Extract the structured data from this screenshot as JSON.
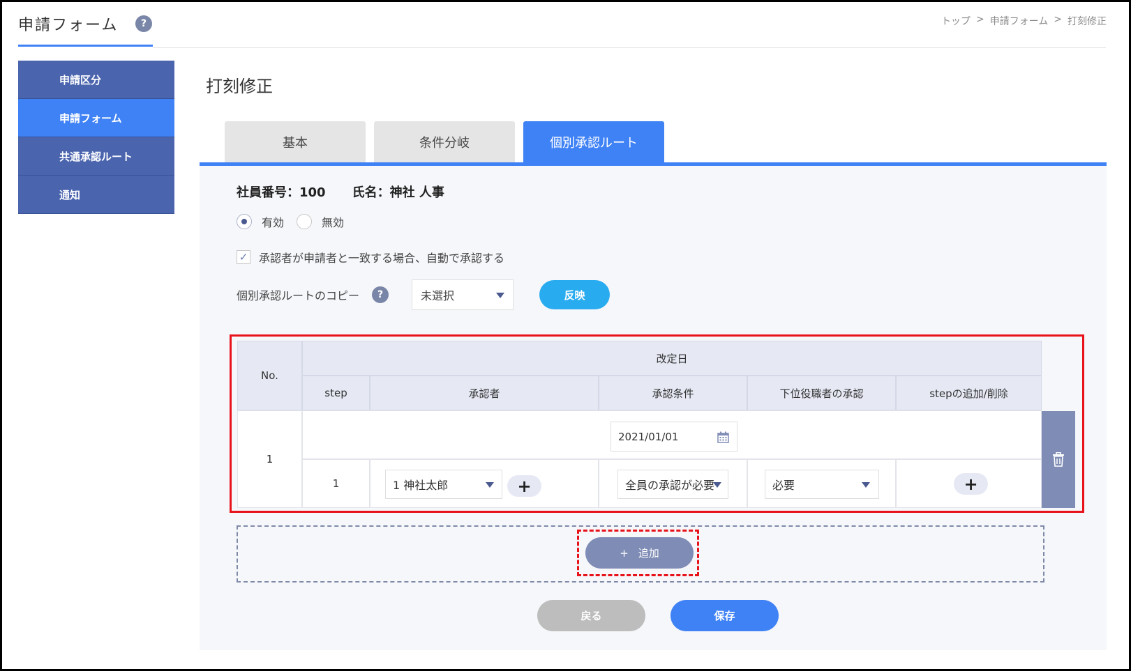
{
  "header": {
    "app_title": "申請フォーム",
    "help_icon": "?",
    "breadcrumb": [
      "トップ",
      ">",
      "申請フォーム",
      ">",
      "打刻修正"
    ]
  },
  "sidebar": {
    "items": [
      {
        "label": "申請区分",
        "active": false
      },
      {
        "label": "申請フォーム",
        "active": true
      },
      {
        "label": "共通承認ルート",
        "active": false
      },
      {
        "label": "通知",
        "active": false
      }
    ]
  },
  "page": {
    "title": "打刻修正",
    "tabs": [
      {
        "label": "基本",
        "active": false
      },
      {
        "label": "条件分岐",
        "active": false
      },
      {
        "label": "個別承認ルート",
        "active": true
      }
    ]
  },
  "employee": {
    "number_label": "社員番号：100",
    "name_label": "氏名：神社 人事"
  },
  "status": {
    "options": [
      "有効",
      "無効"
    ],
    "selected": "有効"
  },
  "auto_approve": {
    "checked": true,
    "label": "承認者が申請者と一致する場合、自動で承認する"
  },
  "copy": {
    "label": "個別承認ルートのコピー",
    "help_icon": "?",
    "selected": "未選択",
    "reflect_label": "反映"
  },
  "table": {
    "headers": {
      "no": "No.",
      "revision_date": "改定日",
      "step": "step",
      "approver": "承認者",
      "condition": "承認条件",
      "subordinate": "下位役職者の承認",
      "step_edit": "stepの追加/削除"
    },
    "rows": [
      {
        "no": "1",
        "revision_date": "2021/01/01",
        "step": "1",
        "approver": "1 神社太郎",
        "condition": "全員の承認が必要",
        "subordinate": "必要",
        "add_symbol": "+"
      }
    ]
  },
  "add_button_label": "追加",
  "add_button_symbol": "+",
  "back_label": "戻る",
  "save_label": "保存",
  "colors": {
    "accent": "#3f82f5",
    "sidebar": "#4a64ae",
    "reflect": "#29abf0",
    "highlight": "#e8121a",
    "muted_button": "#7f8cb5"
  }
}
